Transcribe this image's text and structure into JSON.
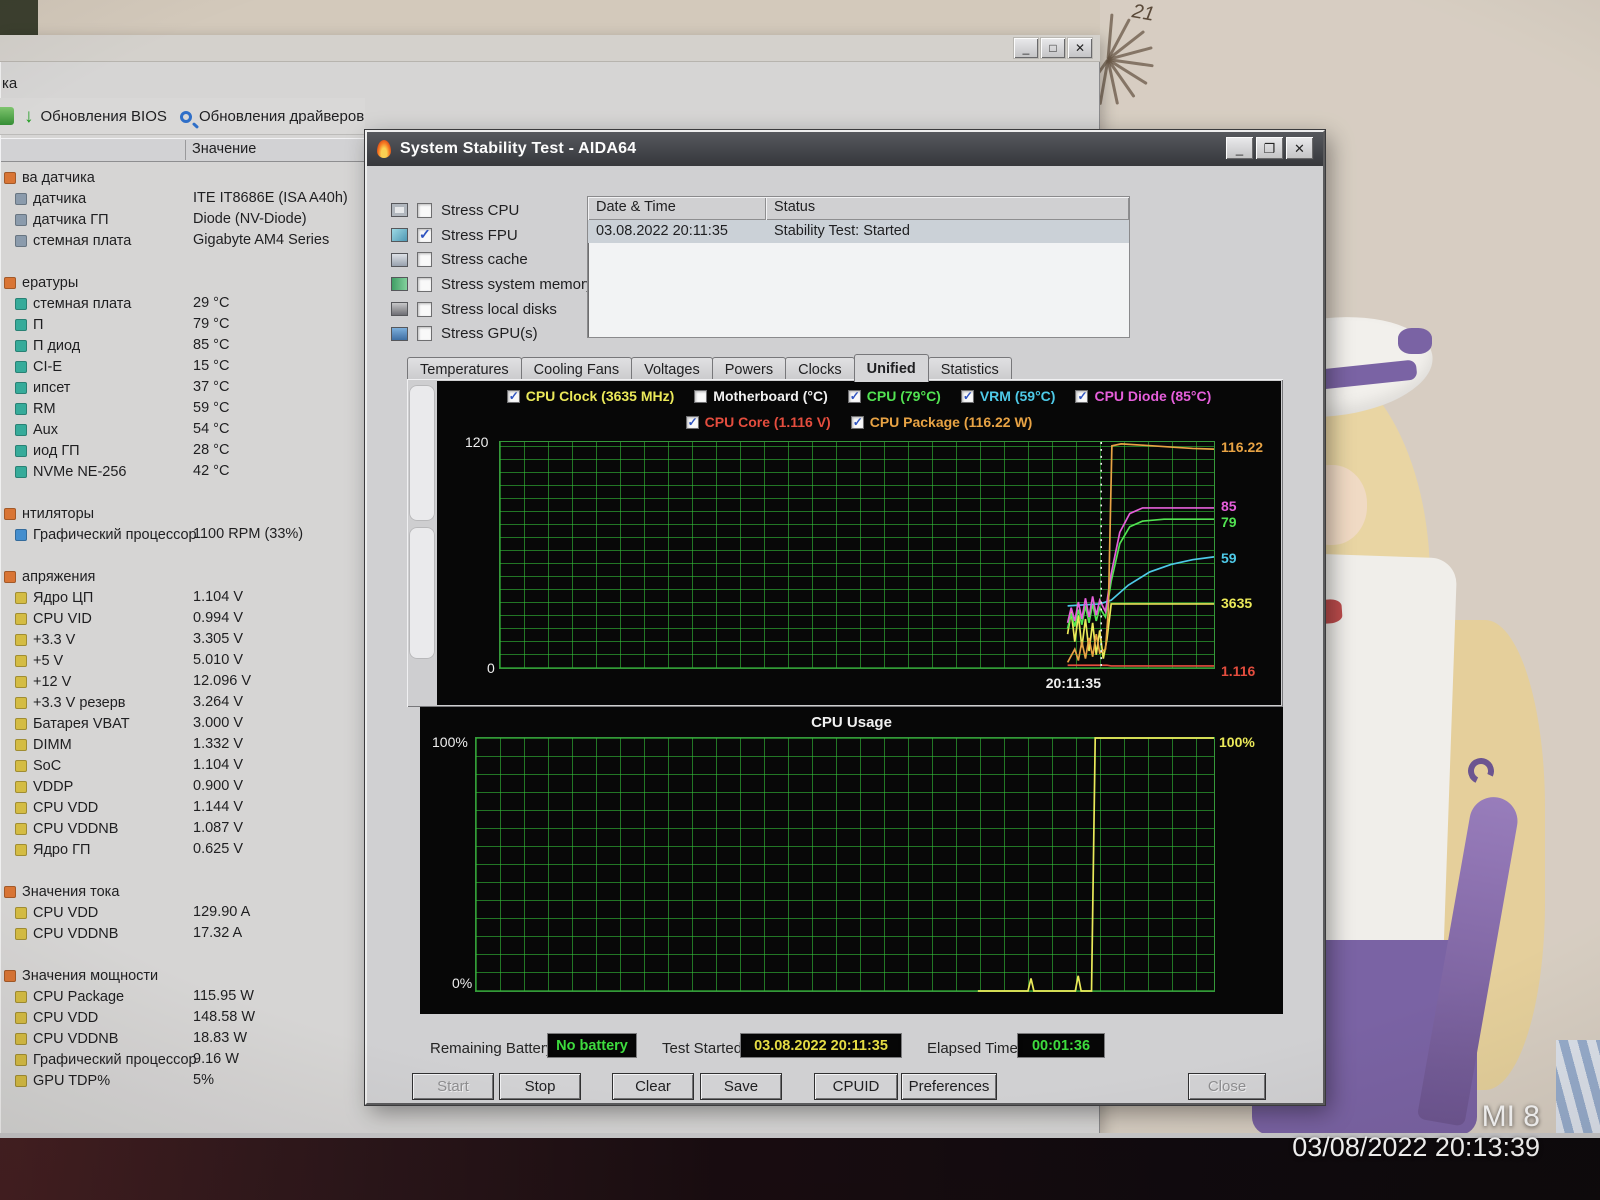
{
  "watermark": {
    "device": "MI 8",
    "datetime": "03/08/2022 20:13:39"
  },
  "wallpaper": {
    "doodle_text": "21"
  },
  "background_app": {
    "menu_fragment": "ка",
    "toolbar": [
      {
        "label": "Обновления BIOS"
      },
      {
        "label": "Обновления драйверов"
      }
    ],
    "value_header": "Значение",
    "sensors": [
      {
        "kind": "section",
        "label": "ва датчика",
        "value": ""
      },
      {
        "kind": "item",
        "label": "датчика",
        "value": "ITE IT8686E  (ISA A40h)"
      },
      {
        "kind": "item",
        "label": "датчика ГП",
        "value": "Diode  (NV-Diode)"
      },
      {
        "kind": "item",
        "label": "стемная плата",
        "value": "Gigabyte AM4 Series"
      },
      {
        "kind": "spacer",
        "label": "",
        "value": ""
      },
      {
        "kind": "section",
        "label": "ературы",
        "value": ""
      },
      {
        "kind": "temp",
        "label": "стемная плата",
        "value": "29 °C"
      },
      {
        "kind": "temp",
        "label": "П",
        "value": "79 °C"
      },
      {
        "kind": "temp",
        "label": "П диод",
        "value": "85 °C"
      },
      {
        "kind": "temp",
        "label": "CI-E",
        "value": "15 °C"
      },
      {
        "kind": "temp",
        "label": "ипсет",
        "value": "37 °C"
      },
      {
        "kind": "temp",
        "label": "RM",
        "value": "59 °C"
      },
      {
        "kind": "temp",
        "label": "Aux",
        "value": "54 °C"
      },
      {
        "kind": "temp",
        "label": "иод ГП",
        "value": "28 °C"
      },
      {
        "kind": "temp",
        "label": "NVMe NE-256",
        "value": "42 °C"
      },
      {
        "kind": "spacer",
        "label": "",
        "value": ""
      },
      {
        "kind": "section",
        "label": "нтиляторы",
        "value": ""
      },
      {
        "kind": "fan",
        "label": "Графический процессор",
        "value": "1100 RPM  (33%)"
      },
      {
        "kind": "spacer",
        "label": "",
        "value": ""
      },
      {
        "kind": "section",
        "label": "апряжения",
        "value": ""
      },
      {
        "kind": "volt",
        "label": "Ядро ЦП",
        "value": "1.104 V"
      },
      {
        "kind": "volt",
        "label": "CPU VID",
        "value": "0.994 V"
      },
      {
        "kind": "volt",
        "label": "+3.3 V",
        "value": "3.305 V"
      },
      {
        "kind": "volt",
        "label": "+5 V",
        "value": "5.010 V"
      },
      {
        "kind": "volt",
        "label": "+12 V",
        "value": "12.096 V"
      },
      {
        "kind": "volt",
        "label": "+3.3 V резерв",
        "value": "3.264 V"
      },
      {
        "kind": "volt",
        "label": "Батарея VBAT",
        "value": "3.000 V"
      },
      {
        "kind": "volt",
        "label": "DIMM",
        "value": "1.332 V"
      },
      {
        "kind": "volt",
        "label": "SoC",
        "value": "1.104 V"
      },
      {
        "kind": "volt",
        "label": "VDDP",
        "value": "0.900 V"
      },
      {
        "kind": "volt",
        "label": "CPU VDD",
        "value": "1.144 V"
      },
      {
        "kind": "volt",
        "label": "CPU VDDNB",
        "value": "1.087 V"
      },
      {
        "kind": "volt",
        "label": "Ядро ГП",
        "value": "0.625 V"
      },
      {
        "kind": "spacer",
        "label": "",
        "value": ""
      },
      {
        "kind": "section",
        "label": "Значения тока",
        "value": ""
      },
      {
        "kind": "amp",
        "label": "CPU VDD",
        "value": "129.90 A"
      },
      {
        "kind": "amp",
        "label": "CPU VDDNB",
        "value": "17.32 A"
      },
      {
        "kind": "spacer",
        "label": "",
        "value": ""
      },
      {
        "kind": "section",
        "label": "Значения мощности",
        "value": ""
      },
      {
        "kind": "watt",
        "label": "CPU Package",
        "value": "115.95 W"
      },
      {
        "kind": "watt",
        "label": "CPU VDD",
        "value": "148.58 W"
      },
      {
        "kind": "watt",
        "label": "CPU VDDNB",
        "value": "18.83 W"
      },
      {
        "kind": "watt",
        "label": "Графический процессор",
        "value": "9.16 W"
      },
      {
        "kind": "watt",
        "label": "GPU TDP%",
        "value": "5%"
      }
    ]
  },
  "stability_window": {
    "title": "System Stability Test - AIDA64",
    "stress_options": [
      {
        "label": "Stress CPU",
        "checked": false,
        "icon": "cpu-icon"
      },
      {
        "label": "Stress FPU",
        "checked": true,
        "icon": "fpu-icon"
      },
      {
        "label": "Stress cache",
        "checked": false,
        "icon": "cache-icon"
      },
      {
        "label": "Stress system memory",
        "checked": false,
        "icon": "memory-icon"
      },
      {
        "label": "Stress local disks",
        "checked": false,
        "icon": "disk-icon"
      },
      {
        "label": "Stress GPU(s)",
        "checked": false,
        "icon": "gpu-icon"
      }
    ],
    "log": {
      "headers": [
        "Date & Time",
        "Status"
      ],
      "rows": [
        {
          "datetime": "03.08.2022 20:11:35",
          "status": "Stability Test: Started"
        }
      ]
    },
    "tabs": {
      "items": [
        "Temperatures",
        "Cooling Fans",
        "Voltages",
        "Powers",
        "Clocks",
        "Unified",
        "Statistics"
      ],
      "active": "Unified"
    },
    "unified": {
      "legend_row1": [
        {
          "label": "CPU Clock (3635 MHz)",
          "checked": true,
          "color": "#eeec50"
        },
        {
          "label": "Motherboard (°C)",
          "checked": false,
          "color": "#f2f2f2"
        },
        {
          "label": "CPU (79°C)",
          "checked": true,
          "color": "#4ae84a"
        },
        {
          "label": "VRM (59°C)",
          "checked": true,
          "color": "#46cdee"
        },
        {
          "label": "CPU Diode (85°C)",
          "checked": true,
          "color": "#ee5ce2"
        }
      ],
      "legend_row2": [
        {
          "label": "CPU Core (1.116 V)",
          "checked": true,
          "color": "#ee4a3a"
        },
        {
          "label": "CPU Package (116.22 W)",
          "checked": true,
          "color": "#eea33c"
        }
      ],
      "y_top": "120",
      "y_bottom": "0",
      "cursor_time": "20:11:35",
      "right_labels": [
        {
          "text": "116.22",
          "color": "#eea33c",
          "pos": 116.2
        },
        {
          "text": "85",
          "color": "#ee5ce2",
          "pos": 85
        },
        {
          "text": "79",
          "color": "#4ae84a",
          "pos": 77
        },
        {
          "text": "59",
          "color": "#46cdee",
          "pos": 58
        },
        {
          "text": "3635",
          "color": "#eeec50",
          "pos": 34
        },
        {
          "text": "1.116",
          "color": "#ee4a3a",
          "pos": -1.5
        }
      ]
    },
    "usage": {
      "title": "CPU Usage",
      "left_top": "100%",
      "left_bottom": "0%",
      "right_label": "100%"
    },
    "status": {
      "battery_label": "Remaining Battery:",
      "battery_value": "No battery",
      "started_label": "Test Started:",
      "started_value": "03.08.2022 20:11:35",
      "elapsed_label": "Elapsed Time:",
      "elapsed_value": "00:01:36"
    },
    "buttons": [
      {
        "label": "Start",
        "enabled": false
      },
      {
        "label": "Stop",
        "enabled": true
      },
      {
        "label": "Clear",
        "enabled": true
      },
      {
        "label": "Save",
        "enabled": true
      },
      {
        "label": "CPUID",
        "enabled": true
      },
      {
        "label": "Preferences",
        "enabled": true
      },
      {
        "label": "Close",
        "enabled": false
      }
    ]
  },
  "chart_data": [
    {
      "type": "line",
      "title": "Unified sensor graph",
      "ylim": [
        0,
        120
      ],
      "note": "points are [x_fraction, plotted value on shared 0-120 canvas]; clock/voltage/power series use their own scales, current readings given per series",
      "cursor_x": 0.842,
      "cursor_label": "20:11:35",
      "legend_position": "top",
      "series": [
        {
          "name": "CPU Clock",
          "unit": "MHz",
          "current": "3635",
          "color": "#eeec50",
          "points": [
            [
              0.795,
              18
            ],
            [
              0.8,
              30
            ],
            [
              0.805,
              14
            ],
            [
              0.81,
              28
            ],
            [
              0.815,
              11
            ],
            [
              0.82,
              26
            ],
            [
              0.825,
              9
            ],
            [
              0.83,
              24
            ],
            [
              0.835,
              7
            ],
            [
              0.84,
              20
            ],
            [
              0.845,
              5
            ],
            [
              0.85,
              15
            ],
            [
              0.856,
              34
            ],
            [
              1,
              34
            ]
          ]
        },
        {
          "name": "Motherboard",
          "unit": "°C",
          "current": "",
          "color": "#f2f2f2",
          "points": []
        },
        {
          "name": "CPU",
          "unit": "°C",
          "current": "79",
          "color": "#4ae84a",
          "points": [
            [
              0.795,
              21
            ],
            [
              0.8,
              29
            ],
            [
              0.805,
              22
            ],
            [
              0.81,
              31
            ],
            [
              0.815,
              23
            ],
            [
              0.82,
              33
            ],
            [
              0.825,
              24
            ],
            [
              0.83,
              34
            ],
            [
              0.835,
              25
            ],
            [
              0.84,
              32
            ],
            [
              0.848,
              27
            ],
            [
              0.856,
              46
            ],
            [
              0.868,
              66
            ],
            [
              0.882,
              75
            ],
            [
              0.9,
              78
            ],
            [
              0.93,
              79
            ],
            [
              1,
              79
            ]
          ]
        },
        {
          "name": "VRM",
          "unit": "°C",
          "current": "59",
          "color": "#46cdee",
          "points": [
            [
              0.795,
              33
            ],
            [
              0.84,
              34
            ],
            [
              0.856,
              36
            ],
            [
              0.88,
              44
            ],
            [
              0.91,
              51
            ],
            [
              0.94,
              55
            ],
            [
              0.97,
              57.5
            ],
            [
              1,
              59
            ]
          ]
        },
        {
          "name": "CPU Diode",
          "unit": "°C",
          "current": "85",
          "color": "#ee5ce2",
          "points": [
            [
              0.795,
              24
            ],
            [
              0.8,
              32
            ],
            [
              0.805,
              25
            ],
            [
              0.81,
              35
            ],
            [
              0.815,
              26
            ],
            [
              0.82,
              37
            ],
            [
              0.825,
              27
            ],
            [
              0.83,
              38
            ],
            [
              0.835,
              28
            ],
            [
              0.84,
              36
            ],
            [
              0.848,
              30
            ],
            [
              0.856,
              50
            ],
            [
              0.868,
              72
            ],
            [
              0.882,
              82
            ],
            [
              0.9,
              85
            ],
            [
              1,
              85
            ]
          ]
        },
        {
          "name": "CPU Core",
          "unit": "V",
          "current": "1.116",
          "color": "#ee4a3a",
          "points": [
            [
              0.795,
              1.5
            ],
            [
              0.85,
              1.5
            ],
            [
              0.856,
              1.1
            ],
            [
              1,
              1.1
            ]
          ]
        },
        {
          "name": "CPU Package",
          "unit": "W",
          "current": "116.22",
          "color": "#eea33c",
          "points": [
            [
              0.795,
              3
            ],
            [
              0.805,
              10
            ],
            [
              0.81,
              4
            ],
            [
              0.815,
              14
            ],
            [
              0.82,
              5
            ],
            [
              0.825,
              16
            ],
            [
              0.83,
              6
            ],
            [
              0.835,
              18
            ],
            [
              0.84,
              8
            ],
            [
              0.848,
              10
            ],
            [
              0.852,
              30
            ],
            [
              0.857,
              118
            ],
            [
              0.87,
              119
            ],
            [
              0.9,
              118.3
            ],
            [
              0.94,
              117.3
            ],
            [
              0.97,
              116.6
            ],
            [
              1,
              116.2
            ]
          ]
        }
      ]
    },
    {
      "type": "line",
      "title": "CPU Usage",
      "ylim": [
        0,
        100
      ],
      "series": [
        {
          "name": "CPU Usage",
          "unit": "%",
          "current": "100%",
          "color": "#eeec50",
          "points": [
            [
              0.68,
              0
            ],
            [
              0.748,
              0
            ],
            [
              0.752,
              5
            ],
            [
              0.756,
              0
            ],
            [
              0.812,
              0
            ],
            [
              0.816,
              6
            ],
            [
              0.82,
              0
            ],
            [
              0.834,
              0
            ],
            [
              0.839,
              100
            ],
            [
              1,
              100
            ]
          ]
        }
      ]
    }
  ]
}
